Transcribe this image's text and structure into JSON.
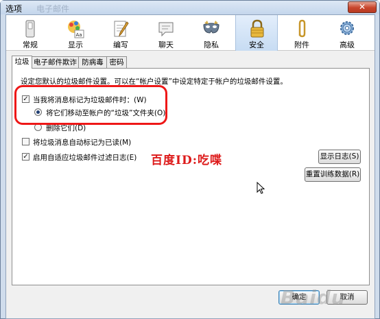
{
  "window": {
    "title": "选项",
    "title_ghost": "电子邮件",
    "close_label": "✕"
  },
  "toolbar": {
    "items": [
      {
        "label": "常规",
        "icon": "switch-icon",
        "selected": false
      },
      {
        "label": "显示",
        "icon": "palette-icon",
        "selected": false
      },
      {
        "label": "编写",
        "icon": "compose-icon",
        "selected": false
      },
      {
        "label": "聊天",
        "icon": "chat-icon",
        "selected": false
      },
      {
        "label": "隐私",
        "icon": "mask-icon",
        "selected": false
      },
      {
        "label": "安全",
        "icon": "lock-icon",
        "selected": true
      },
      {
        "label": "附件",
        "icon": "paperclip-icon",
        "selected": false
      },
      {
        "label": "高级",
        "icon": "gear-icon",
        "selected": false
      }
    ]
  },
  "tabs": [
    {
      "label": "垃圾",
      "active": true
    },
    {
      "label": "电子邮件欺诈",
      "active": false
    },
    {
      "label": "防病毒",
      "active": false
    },
    {
      "label": "密码",
      "active": false
    }
  ],
  "junk": {
    "intro": "设定您默认的垃圾邮件设置。可以在“帐户设置”中设定特定于帐户的垃圾邮件设置。",
    "mark_label": "当我将消息标记为垃圾邮件时：(W)",
    "mark_checked": true,
    "move_label": "将它们移动至帐户的“垃圾”文件夹(O)",
    "move_selected": true,
    "delete_label": "删除它们(D)",
    "delete_selected": false,
    "mark_read_label": "将垃圾消息自动标记为已读(M)",
    "mark_read_checked": false,
    "log_label": "启用自适应垃圾邮件过滤日志(E)",
    "log_checked": true,
    "show_log_button": "显示日志(S)",
    "reset_button": "重置训练数据(R)"
  },
  "footer": {
    "ok_button": "确定",
    "cancel_button": "取消"
  },
  "overlay": {
    "annotation": "百度ID:吃喋",
    "logo": "Baidu"
  }
}
